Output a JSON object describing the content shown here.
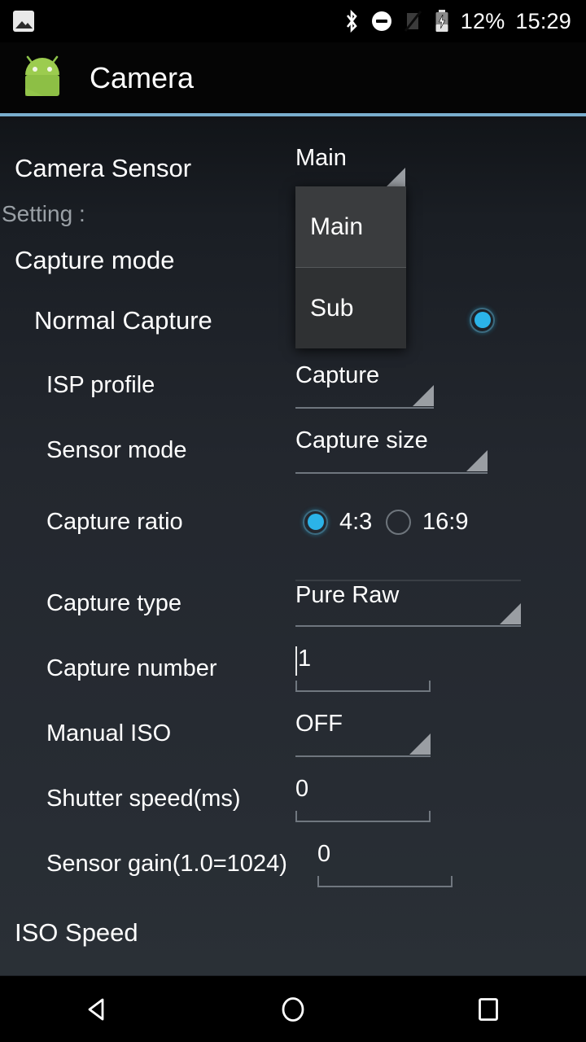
{
  "status_bar": {
    "left_icon": "photo-icon",
    "icons": [
      "bluetooth-icon",
      "do-not-disturb-icon",
      "signal-off-icon",
      "battery-charging-icon"
    ],
    "battery_percent": "12%",
    "clock": "15:29"
  },
  "app_bar": {
    "icon": "android-robot-icon",
    "title": "Camera",
    "divider_color": "#79aecd"
  },
  "settings": {
    "camera_sensor": {
      "label": "Camera Sensor",
      "value": "Main",
      "options": [
        "Main",
        "Sub"
      ],
      "selected_option": "Main"
    },
    "setting_header": "Setting :",
    "capture_mode": {
      "label": "Capture mode",
      "item_label": "Normal Capture",
      "selected": true
    },
    "isp_profile": {
      "label": "ISP profile",
      "value": "Capture"
    },
    "sensor_mode": {
      "label": "Sensor mode",
      "value": "Capture size"
    },
    "capture_ratio": {
      "label": "Capture ratio",
      "options": [
        "4:3",
        "16:9"
      ],
      "selected": "4:3"
    },
    "capture_type": {
      "label": "Capture type",
      "value": "Pure Raw"
    },
    "capture_number": {
      "label": "Capture number",
      "value": "1"
    },
    "manual_iso": {
      "label": "Manual ISO",
      "value": "OFF"
    },
    "shutter_speed": {
      "label": "Shutter speed(ms)",
      "value": "0"
    },
    "sensor_gain": {
      "label": "Sensor gain(1.0=1024)",
      "value": "0"
    },
    "iso_speed_header": "ISO Speed"
  },
  "nav_bar": {
    "back": "back-icon",
    "home": "home-icon",
    "recents": "recents-icon"
  },
  "colors": {
    "accent": "#2bb3e8",
    "app_bar_divider": "#79aecd",
    "background": "#23272e"
  }
}
